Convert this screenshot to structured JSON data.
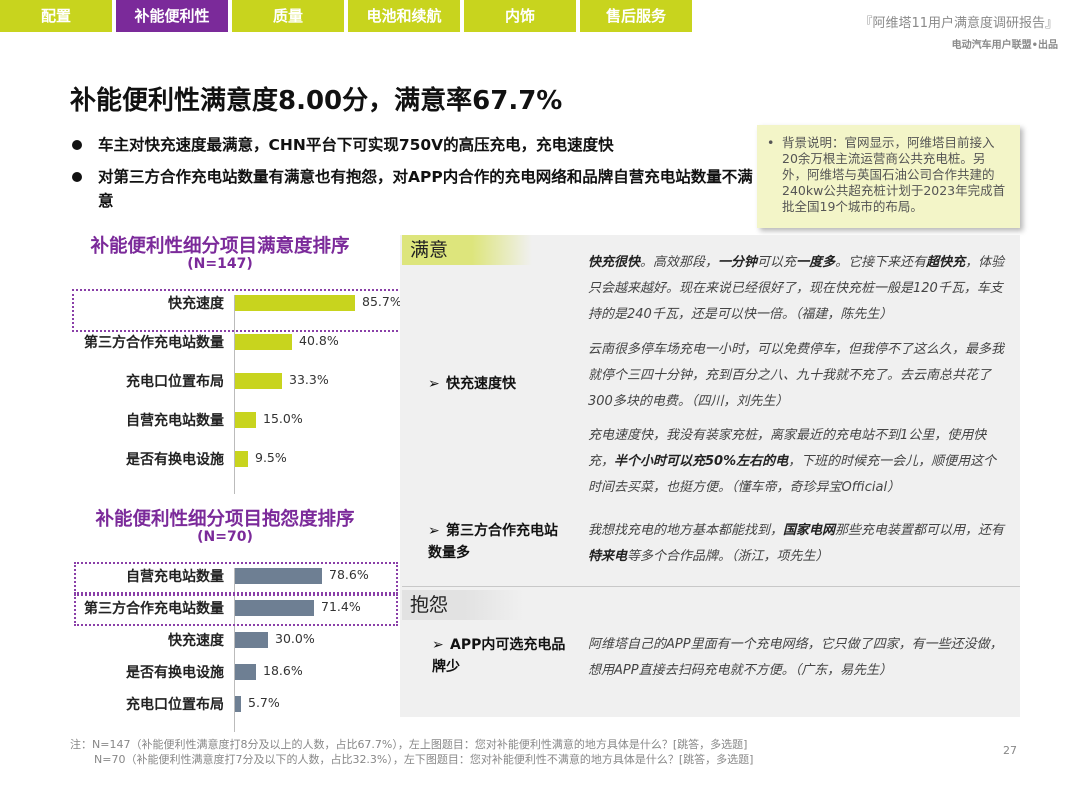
{
  "nav": {
    "tabs": [
      {
        "label": "配置",
        "active": false
      },
      {
        "label": "补能便利性",
        "active": true
      },
      {
        "label": "质量",
        "active": false
      },
      {
        "label": "电池和续航",
        "active": false
      },
      {
        "label": "内饰",
        "active": false
      },
      {
        "label": "售后服务",
        "active": false
      }
    ]
  },
  "report": {
    "title": "『阿维塔11用户满意度调研报告』",
    "subtitle": "电动汽车用户联盟•出品"
  },
  "headline": "补能便利性满意度8.00分，满意率67.7%",
  "bullets": [
    "车主对快充速度最满意，CHN平台下可实现750V的高压充电，充电速度快",
    "对第三方合作充电站数量有满意也有抱怨，对APP内合作的充电网络和品牌自营充电站数量不满意"
  ],
  "background_note": {
    "marker": "•",
    "text": "背景说明：官网显示，阿维塔目前接入20余万根主流运营商公共充电桩。另外，阿维塔与英国石油公司合作共建的240kw公共超充桩计划于2023年完成首批全国19个城市的布局。"
  },
  "chart_data": [
    {
      "type": "bar",
      "orientation": "horizontal",
      "title": "补能便利性细分项目满意度排序",
      "subtitle": "(N=147)",
      "categories": [
        "快充速度",
        "第三方合作充电站数量",
        "充电口位置布局",
        "自营充电站数量",
        "是否有换电设施"
      ],
      "values": [
        85.7,
        40.8,
        33.3,
        15.0,
        9.5
      ],
      "value_labels": [
        "85.7%",
        "40.8%",
        "33.3%",
        "15.0%",
        "9.5%"
      ],
      "unit": "%",
      "color": "#c8d41e",
      "highlighted": [
        "快充速度"
      ]
    },
    {
      "type": "bar",
      "orientation": "horizontal",
      "title": "补能便利性细分项目抱怨度排序",
      "subtitle": "(N=70)",
      "categories": [
        "自营充电站数量",
        "第三方合作充电站数量",
        "快充速度",
        "是否有换电设施",
        "充电口位置布局"
      ],
      "values": [
        78.6,
        71.4,
        30.0,
        18.6,
        5.7
      ],
      "value_labels": [
        "78.6%",
        "71.4%",
        "30.0%",
        "18.6%",
        "5.7%"
      ],
      "unit": "%",
      "color": "#6e7f93",
      "highlighted": [
        "自营充电站数量",
        "第三方合作充电站数量"
      ]
    }
  ],
  "satisfied": {
    "tag": "满意",
    "items": [
      {
        "label": "快充速度快",
        "quotes": [
          "<b>快充很快</b>。高效那段，<b>一分钟</b>可以充<b>一度多</b>。它接下来还有<b>超快充</b>，体验只会越来越好。现在来说已经很好了，现在快充桩一般是120千瓦，车支持的是240千瓦，还是可以快一倍。（福建，陈先生）",
          "云南很多停车场充电一小时，可以免费停车，但我停不了这么久，最多我就停个三四十分钟，充到百分之八、九十我就不充了。去云南总共花了300多块的电费。（四川，刘先生）",
          "充电速度快，我没有装家充桩，离家最近的充电站不到1公里，使用快充，<b>半个小时可以充50%左右的电</b>，下班的时候充一会儿，顺便用这个时间去买菜，也挺方便。（懂车帝，奇珍异宝Official）"
        ]
      },
      {
        "label": "第三方合作充电站数量多",
        "quotes": [
          "我想找充电的地方基本都能找到，<b>国家电网</b>那些充电装置都可以用，还有<b>特来电</b>等多个合作品牌。（浙江，项先生）"
        ]
      }
    ]
  },
  "complaints": {
    "tag": "抱怨",
    "items": [
      {
        "label": "APP内可选充电品牌少",
        "quotes": [
          "阿维塔自己的APP里面有一个充电网络，它只做了四家，有一些还没做，想用APP直接去扫码充电就不方便。（广东，易先生）"
        ]
      }
    ]
  },
  "footnote": [
    "注：N=147（补能便利性满意度打8分及以上的人数，占比67.7%），左上图题目：您对补能便利性满意的地方具体是什么？[跳答，多选题]",
    "N=70（补能便利性满意度打7分及以下的人数，占比32.3%），左下图题目：您对补能便利性不满意的地方具体是什么？[跳答，多选题]"
  ],
  "page_number": "27"
}
